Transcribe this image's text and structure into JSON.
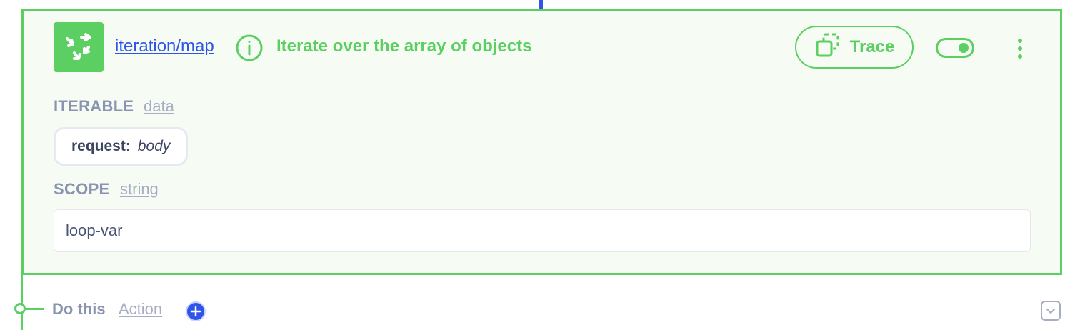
{
  "step": {
    "module": "iteration/map",
    "description": "Iterate over the array of objects",
    "icon": "loop-arrows-icon",
    "trace_label": "Trace",
    "enabled": true,
    "accent_color": "#5ccf62",
    "link_color": "#2f55e8"
  },
  "iterable": {
    "label": "ITERABLE",
    "type": "data",
    "value_key": "request:",
    "value_path": "body"
  },
  "scope": {
    "label": "SCOPE",
    "type": "string",
    "value": "loop-var"
  },
  "next": {
    "label": "Do this",
    "type": "Action"
  }
}
